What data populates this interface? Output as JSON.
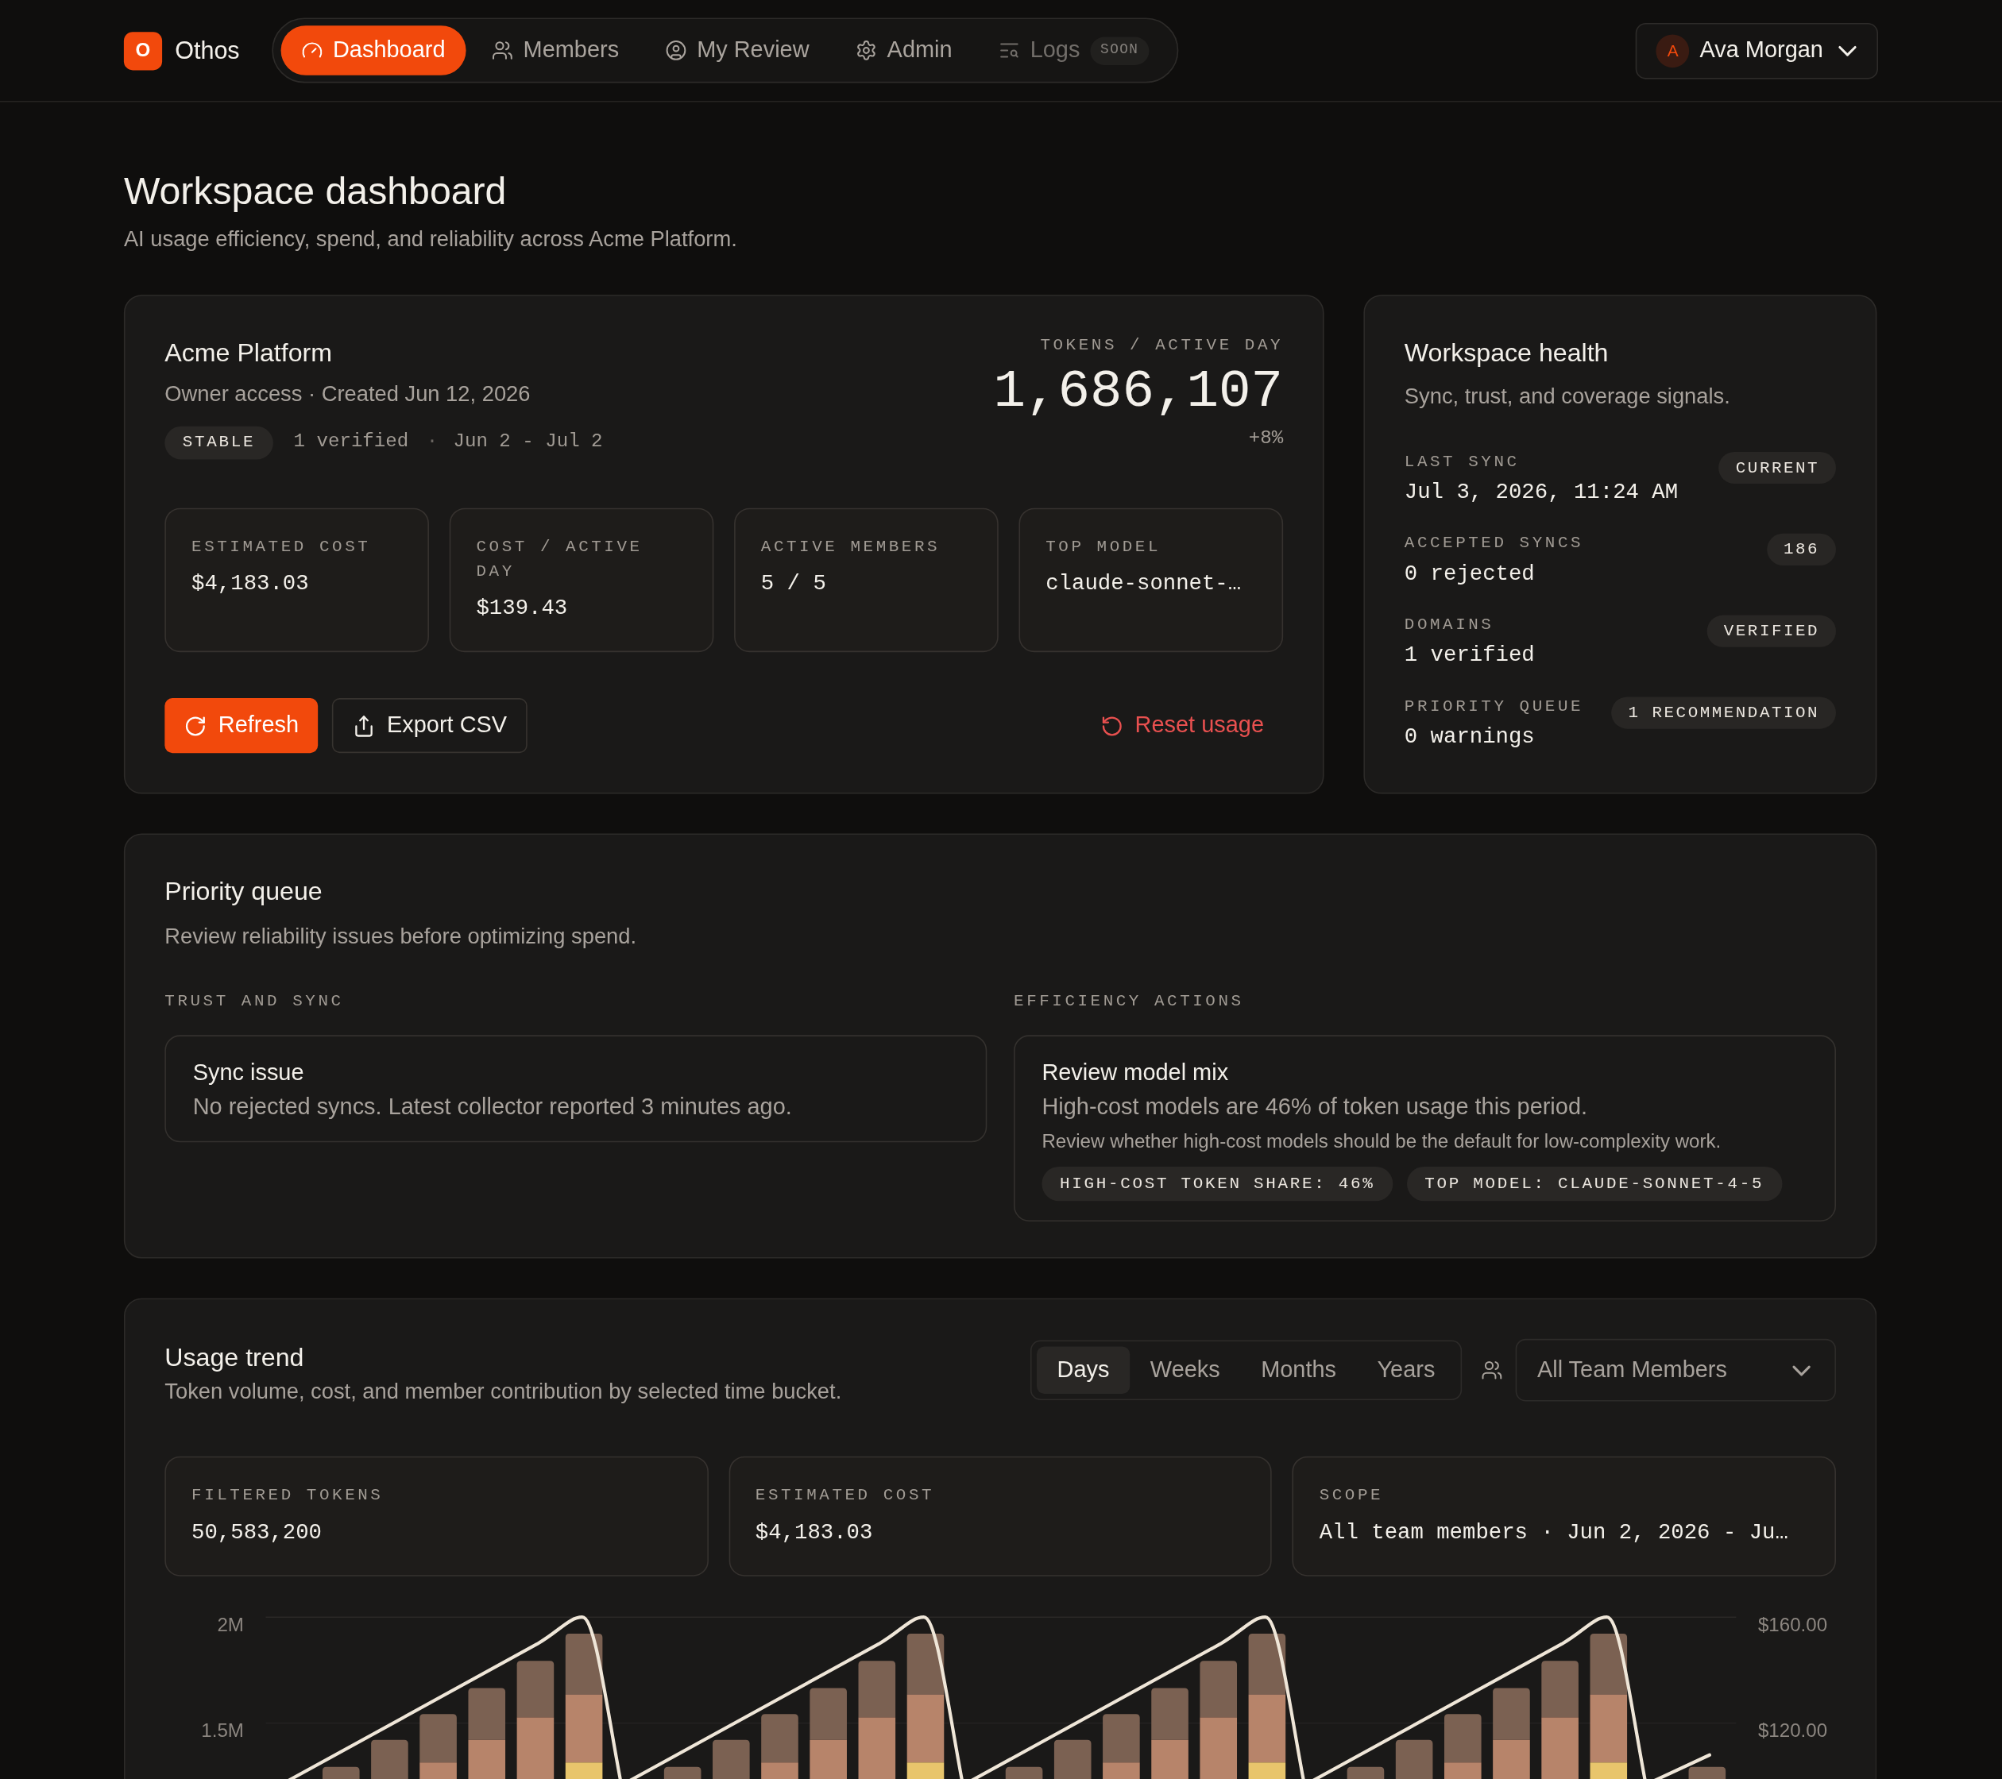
{
  "nav": {
    "logo_mark": "O",
    "brand": "Othos",
    "items": [
      {
        "label": "Dashboard",
        "selected": true,
        "disabled": false
      },
      {
        "label": "Members",
        "selected": false,
        "disabled": false
      },
      {
        "label": "My Review",
        "selected": false,
        "disabled": false
      },
      {
        "label": "Admin",
        "selected": false,
        "disabled": false
      },
      {
        "label": "Logs",
        "selected": false,
        "disabled": true,
        "badge": "SOON"
      }
    ],
    "user": {
      "initial": "A",
      "name": "Ava Morgan"
    }
  },
  "header": {
    "title": "Workspace dashboard",
    "subtitle": "AI usage efficiency, spend, and reliability across Acme Platform."
  },
  "workspace_card": {
    "name": "Acme Platform",
    "meta": "Owner access · Created Jun 12, 2026",
    "status_badge": "STABLE",
    "verified": "1 verified",
    "separator": "·",
    "period": "Jun 2 - Jul 2",
    "headline": {
      "label": "TOKENS / ACTIVE DAY",
      "value": "1,686,107",
      "change": "+8%"
    },
    "stats": [
      {
        "label": "ESTIMATED COST",
        "value": "$4,183.03"
      },
      {
        "label": "COST / ACTIVE DAY",
        "value": "$139.43"
      },
      {
        "label": "ACTIVE MEMBERS",
        "value": "5 / 5"
      },
      {
        "label": "TOP MODEL",
        "value": "claude-sonnet-…"
      }
    ],
    "actions": [
      {
        "label": "Refresh",
        "kind": "primary"
      },
      {
        "label": "Export CSV",
        "kind": "secondary"
      },
      {
        "label": "Reset usage",
        "kind": "danger"
      }
    ]
  },
  "workspace_health": {
    "title": "Workspace health",
    "subtitle": "Sync, trust, and coverage signals.",
    "rows": [
      {
        "label": "LAST SYNC",
        "value": "Jul 3, 2026, 11:24 AM",
        "badge": "CURRENT"
      },
      {
        "label": "ACCEPTED SYNCS",
        "value": "0 rejected",
        "badge": "186"
      },
      {
        "label": "DOMAINS",
        "value": "1 verified",
        "badge": "VERIFIED"
      },
      {
        "label": "PRIORITY QUEUE",
        "value": "0 warnings",
        "badge": "1 RECOMMENDATION"
      }
    ]
  },
  "priority_queue": {
    "title": "Priority queue",
    "subtitle": "Review reliability issues before optimizing spend.",
    "columns": [
      {
        "heading": "TRUST AND SYNC",
        "items": [
          {
            "title": "Sync issue",
            "body": "No rejected syncs. Latest collector reported 3 minutes ago."
          }
        ]
      },
      {
        "heading": "EFFICIENCY ACTIONS",
        "items": [
          {
            "title": "Review model mix",
            "body": "High-cost models are 46% of token usage this period.",
            "note": "Review whether high-cost models should be the default for low-complexity work.",
            "tags": [
              "HIGH-COST TOKEN SHARE: 46%",
              "TOP MODEL: CLAUDE-SONNET-4-5"
            ]
          }
        ]
      }
    ]
  },
  "usage_trend": {
    "title": "Usage trend",
    "subtitle": "Token volume, cost, and member contribution by selected time bucket.",
    "buckets": [
      {
        "label": "Days",
        "selected": true
      },
      {
        "label": "Weeks",
        "selected": false
      },
      {
        "label": "Months",
        "selected": false
      },
      {
        "label": "Years",
        "selected": false
      }
    ],
    "member_filter": {
      "value": "All Team Members"
    },
    "stats": [
      {
        "label": "FILTERED TOKENS",
        "value": "50,583,200"
      },
      {
        "label": "ESTIMATED COST",
        "value": "$4,183.03"
      },
      {
        "label": "SCOPE",
        "value": "All team members · Jun 2, 2026 - Ju…"
      }
    ],
    "chart": {
      "y_axis_left": [
        "2M",
        "1.5M"
      ],
      "y_axis_right": [
        "$160.00",
        "$120.00"
      ]
    }
  }
}
